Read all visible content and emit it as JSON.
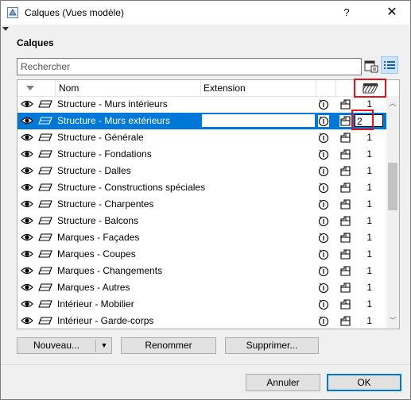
{
  "window": {
    "title": "Calques (Vues modèle)",
    "help_label": "?",
    "close_label": "✕"
  },
  "section_label": "Calques",
  "search": {
    "placeholder": "Rechercher",
    "value": ""
  },
  "columns": {
    "name": "Nom",
    "extension": "Extension"
  },
  "rows": [
    {
      "name": "Structure - Murs intérieurs",
      "pen": "1",
      "selected": false
    },
    {
      "name": "Structure - Murs extérieurs",
      "pen": "2",
      "selected": true
    },
    {
      "name": "Structure - Générale",
      "pen": "1",
      "selected": false
    },
    {
      "name": "Structure - Fondations",
      "pen": "1",
      "selected": false
    },
    {
      "name": "Structure - Dalles",
      "pen": "1",
      "selected": false
    },
    {
      "name": "Structure - Constructions spéciales",
      "pen": "1",
      "selected": false
    },
    {
      "name": "Structure - Charpentes",
      "pen": "1",
      "selected": false
    },
    {
      "name": "Structure - Balcons",
      "pen": "1",
      "selected": false
    },
    {
      "name": "Marques - Façades",
      "pen": "1",
      "selected": false
    },
    {
      "name": "Marques - Coupes",
      "pen": "1",
      "selected": false
    },
    {
      "name": "Marques - Changements",
      "pen": "1",
      "selected": false
    },
    {
      "name": "Marques - Autres",
      "pen": "1",
      "selected": false
    },
    {
      "name": "Intérieur - Mobilier",
      "pen": "1",
      "selected": false
    },
    {
      "name": "Intérieur - Garde-corps",
      "pen": "1",
      "selected": false
    }
  ],
  "buttons": {
    "new_label": "Nouveau...",
    "rename_label": "Renommer",
    "delete_label": "Supprimer...",
    "cancel_label": "Annuler",
    "ok_label": "OK"
  },
  "icons": {
    "visibility": "eye-icon",
    "lock": "layer-lock-icon",
    "wireframe": "wireframe-icon",
    "solid": "solid-icon",
    "intersection_group": "intersection-group-icon"
  },
  "colors": {
    "selection": "#0078d7",
    "highlight": "#e0141e"
  }
}
